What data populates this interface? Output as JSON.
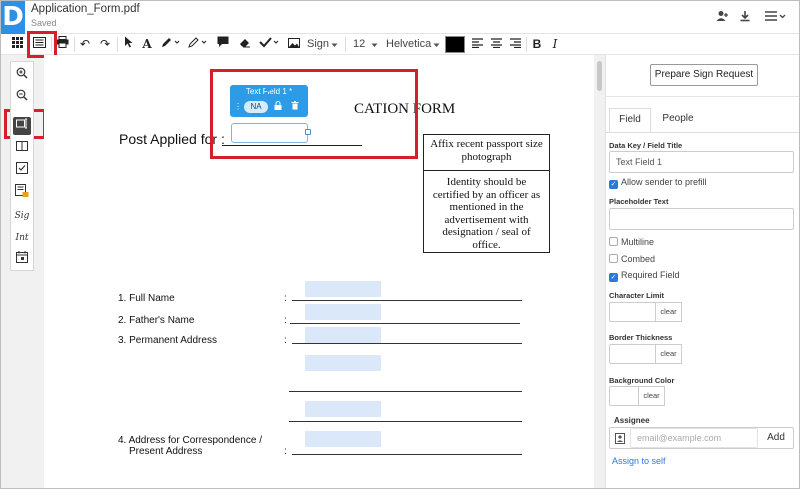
{
  "header": {
    "logo": "D",
    "title": "Application_Form.pdf",
    "status": "Saved",
    "icons": [
      "add-user-icon",
      "download-icon",
      "menu-icon"
    ]
  },
  "toolbar": {
    "sign_label": "Sign",
    "font_size": "12",
    "font_family": "Helvetica",
    "bold": "B",
    "italic": "I",
    "color": "#000000"
  },
  "document": {
    "title": "CATION FORM",
    "post_label": "Post Applied for :",
    "photo_box": {
      "heading": "Affix recent passport size photograph",
      "body": "Identity should be certified by an officer as mentioned in the advertisement with designation / seal of office."
    },
    "popup": {
      "title": "Text Field 1 *",
      "badge": "NA"
    },
    "fields": [
      {
        "label": "1. Full Name"
      },
      {
        "label": "2. Father's Name"
      },
      {
        "label": "3. Permanent Address"
      },
      {
        "label": "4. Address for Correspondence /"
      },
      {
        "label": "Present Address"
      }
    ],
    "colon": ":"
  },
  "panel": {
    "prepare_button": "Prepare Sign Request",
    "tabs": [
      "Field",
      "People"
    ],
    "data_key_label": "Data Key / Field Title",
    "data_key_value": "Text Field 1",
    "allow_prefill": "Allow sender to prefill",
    "placeholder_label": "Placeholder Text",
    "multiline": "Multiline",
    "combed": "Combed",
    "required": "Required Field",
    "char_limit_label": "Character Limit",
    "border_label": "Border Thickness",
    "bg_color_label": "Background Color",
    "clear": "clear",
    "assignee_label": "Assignee",
    "assignee_placeholder": "email@example.com",
    "add_button": "Add",
    "assign_self": "Assign to self"
  }
}
